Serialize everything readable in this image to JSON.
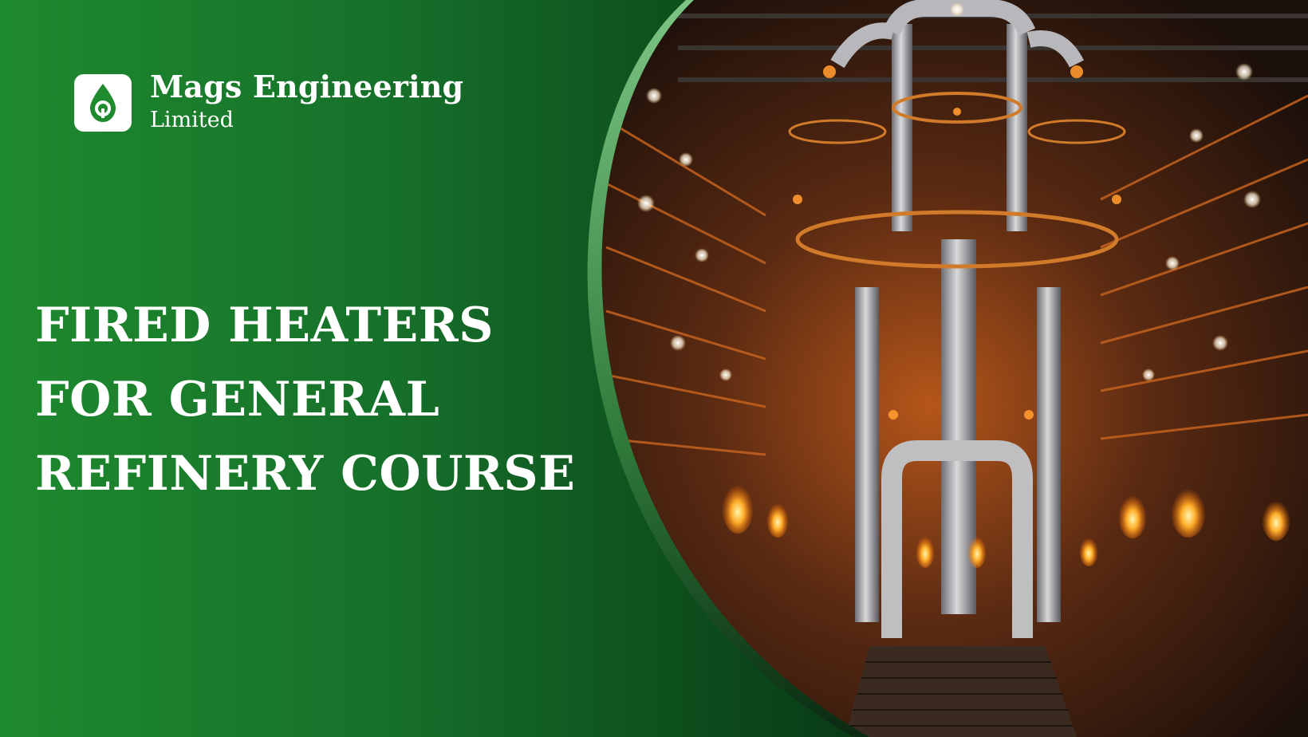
{
  "brand": {
    "name": "Mags Engineering",
    "subtitle": "Limited",
    "logo_icon": "oil-drop-gear-icon",
    "accent": "#1e8a2e"
  },
  "headline": {
    "lines": [
      "FIRED HEATERS",
      "FOR GENERAL",
      "REFINERY COURSE"
    ]
  },
  "hero_image": {
    "icon": "refinery-fired-heater-photo"
  },
  "colors": {
    "green_light": "#1e8a2e",
    "green_dark": "#041c0a",
    "arc_green": "#5fae6a",
    "glow_orange": "#ff8a1f"
  }
}
